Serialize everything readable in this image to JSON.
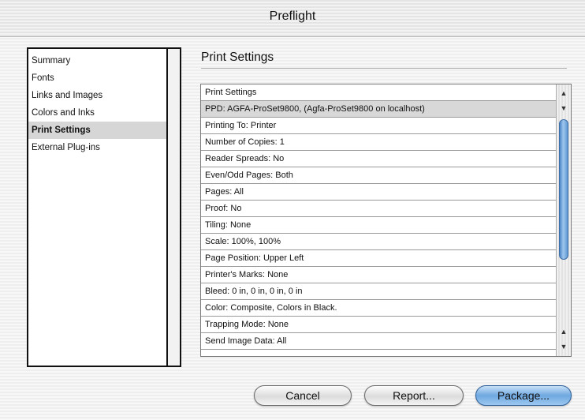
{
  "window": {
    "title": "Preflight"
  },
  "sidebar": {
    "items": [
      {
        "label": "Summary",
        "selected": false
      },
      {
        "label": "Fonts",
        "selected": false
      },
      {
        "label": "Links and Images",
        "selected": false
      },
      {
        "label": "Colors and Inks",
        "selected": false
      },
      {
        "label": "Print Settings",
        "selected": true
      },
      {
        "label": "External Plug-ins",
        "selected": false
      }
    ]
  },
  "main": {
    "section_title": "Print Settings",
    "list": {
      "rows": [
        "Print Settings",
        "PPD: AGFA-ProSet9800, (Agfa-ProSet9800 on localhost)",
        "Printing To: Printer",
        "Number of Copies: 1",
        "Reader Spreads: No",
        "Even/Odd Pages: Both",
        "Pages: All",
        "Proof: No",
        "Tiling: None",
        "Scale: 100%, 100%",
        "Page Position: Upper Left",
        "Printer's Marks: None",
        "Bleed: 0 in, 0 in, 0 in, 0 in",
        "Color: Composite, Colors in Black.",
        "Trapping Mode: None",
        "Send Image Data: All"
      ],
      "selected_index": 1
    },
    "scrollbar": {
      "up_arrow": "▲",
      "down_arrow": "▼"
    }
  },
  "buttons": {
    "cancel": "Cancel",
    "report": "Report...",
    "package": "Package..."
  },
  "colors": {
    "accent": "#6fa8e0",
    "selection": "#d8d8d8"
  }
}
